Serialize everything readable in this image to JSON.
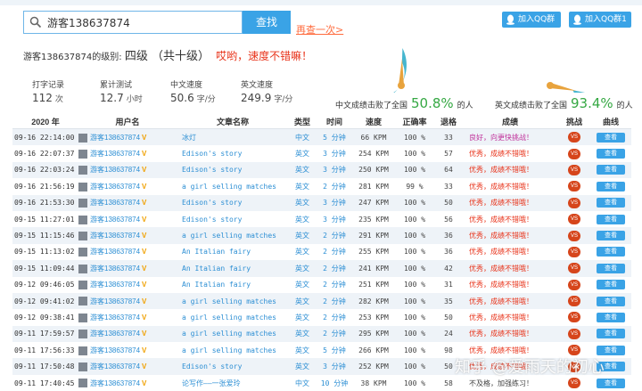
{
  "search": {
    "value": "游客138637874",
    "button": "查找",
    "reset": "再查一次>"
  },
  "qq": [
    {
      "label": "加入QQ群2"
    },
    {
      "label": "加入QQ群1"
    }
  ],
  "level": {
    "prefix": "游客138637874的级别:",
    "level": "四级 （共十级）",
    "praise": "哎哟，速度不错嘛！"
  },
  "stats": [
    {
      "label": "打字记录",
      "value": "112",
      "unit": "次"
    },
    {
      "label": "累计测试",
      "value": "12.7",
      "unit": "小时"
    },
    {
      "label": "中文速度",
      "value": "50.6",
      "unit": "字/分"
    },
    {
      "label": "英文速度",
      "value": "249.9",
      "unit": "字/分"
    }
  ],
  "gauges": [
    {
      "prefix": "中文成绩击败了全国",
      "pct": "50.8%",
      "suffix": "的人",
      "level": 0.508,
      "color": "#46b6cf"
    },
    {
      "prefix": "英文成绩击败了全国",
      "pct": "93.4%",
      "suffix": "的人",
      "level": 0.934,
      "color": "#46b6cf"
    }
  ],
  "table": {
    "headers": [
      "2020 年",
      "用户名",
      "文章名称",
      "类型",
      "时间",
      "速度",
      "正确率",
      "退格",
      "成绩",
      "挑战",
      "曲线"
    ],
    "rows": [
      {
        "date": "09-16 22:14:00",
        "user": "游客138637874",
        "title": "冰灯",
        "type": "中文",
        "time": "5 分钟",
        "speed": "66 KPM",
        "acc": "100 %",
        "bs": "33",
        "result": "良好，向更快挑战！",
        "kind": "good"
      },
      {
        "date": "09-16 22:07:37",
        "user": "游客138637874",
        "title": "Edison's story",
        "type": "英文",
        "time": "3 分钟",
        "speed": "254 KPM",
        "acc": "100 %",
        "bs": "57",
        "result": "优秀，成绩不错哦！",
        "kind": "ok"
      },
      {
        "date": "09-16 22:03:24",
        "user": "游客138637874",
        "title": "Edison's story",
        "type": "英文",
        "time": "3 分钟",
        "speed": "250 KPM",
        "acc": "100 %",
        "bs": "64",
        "result": "优秀，成绩不错哦！",
        "kind": "ok"
      },
      {
        "date": "09-16 21:56:19",
        "user": "游客138637874",
        "title": "a girl selling matches",
        "type": "英文",
        "time": "2 分钟",
        "speed": "281 KPM",
        "acc": "99 %",
        "bs": "33",
        "result": "优秀，成绩不错哦！",
        "kind": "ok"
      },
      {
        "date": "09-16 21:53:30",
        "user": "游客138637874",
        "title": "Edison's story",
        "type": "英文",
        "time": "3 分钟",
        "speed": "247 KPM",
        "acc": "100 %",
        "bs": "50",
        "result": "优秀，成绩不错哦！",
        "kind": "ok"
      },
      {
        "date": "09-15 11:27:01",
        "user": "游客138637874",
        "title": "Edison's story",
        "type": "英文",
        "time": "3 分钟",
        "speed": "235 KPM",
        "acc": "100 %",
        "bs": "56",
        "result": "优秀，成绩不错哦！",
        "kind": "ok"
      },
      {
        "date": "09-15 11:15:46",
        "user": "游客138637874",
        "title": "a girl selling matches",
        "type": "英文",
        "time": "2 分钟",
        "speed": "291 KPM",
        "acc": "100 %",
        "bs": "36",
        "result": "优秀，成绩不错哦！",
        "kind": "ok"
      },
      {
        "date": "09-15 11:13:02",
        "user": "游客138637874",
        "title": "An Italian fairy",
        "type": "英文",
        "time": "2 分钟",
        "speed": "255 KPM",
        "acc": "100 %",
        "bs": "36",
        "result": "优秀，成绩不错哦！",
        "kind": "ok"
      },
      {
        "date": "09-15 11:09:44",
        "user": "游客138637874",
        "title": "An Italian fairy",
        "type": "英文",
        "time": "2 分钟",
        "speed": "241 KPM",
        "acc": "100 %",
        "bs": "42",
        "result": "优秀，成绩不错哦！",
        "kind": "ok"
      },
      {
        "date": "09-12 09:46:05",
        "user": "游客138637874",
        "title": "An Italian fairy",
        "type": "英文",
        "time": "2 分钟",
        "speed": "251 KPM",
        "acc": "100 %",
        "bs": "31",
        "result": "优秀，成绩不错哦！",
        "kind": "ok"
      },
      {
        "date": "09-12 09:41:02",
        "user": "游客138637874",
        "title": "a girl selling matches",
        "type": "英文",
        "time": "2 分钟",
        "speed": "282 KPM",
        "acc": "100 %",
        "bs": "35",
        "result": "优秀，成绩不错哦！",
        "kind": "ok"
      },
      {
        "date": "09-12 09:38:41",
        "user": "游客138637874",
        "title": "a girl selling matches",
        "type": "英文",
        "time": "2 分钟",
        "speed": "253 KPM",
        "acc": "100 %",
        "bs": "50",
        "result": "优秀，成绩不错哦！",
        "kind": "ok"
      },
      {
        "date": "09-11 17:59:57",
        "user": "游客138637874",
        "title": "a girl selling matches",
        "type": "英文",
        "time": "2 分钟",
        "speed": "295 KPM",
        "acc": "100 %",
        "bs": "24",
        "result": "优秀，成绩不错哦！",
        "kind": "ok"
      },
      {
        "date": "09-11 17:56:33",
        "user": "游客138637874",
        "title": "a girl selling matches",
        "type": "英文",
        "time": "5 分钟",
        "speed": "266 KPM",
        "acc": "100 %",
        "bs": "98",
        "result": "优秀，成绩不错哦！",
        "kind": "ok"
      },
      {
        "date": "09-11 17:50:48",
        "user": "游客138637874",
        "title": "Edison's story",
        "type": "英文",
        "time": "3 分钟",
        "speed": "252 KPM",
        "acc": "100 %",
        "bs": "50",
        "result": "优秀，成绩不错哦！",
        "kind": "ok"
      },
      {
        "date": "09-11 17:40:45",
        "user": "游客138637874",
        "title": "论写作——一张爱玲",
        "type": "中文",
        "time": "10 分钟",
        "speed": "38 KPM",
        "acc": "100 %",
        "bs": "58",
        "result": "不及格，加强练习！",
        "kind": "low"
      }
    ],
    "vs_label": "VS",
    "view_label": "查看",
    "vip_label": "V"
  },
  "watermark": "知乎 @爱雨天的初心",
  "colors": {
    "accent": "#3aa3e6",
    "link": "#2d8fd4",
    "alert": "#e8331a",
    "gauge": "#46b6cf",
    "needle": "#e8a33d"
  },
  "icons": {
    "search": "search-icon",
    "qq": "qq-penguin-icon",
    "avatar": "avatar-icon"
  }
}
